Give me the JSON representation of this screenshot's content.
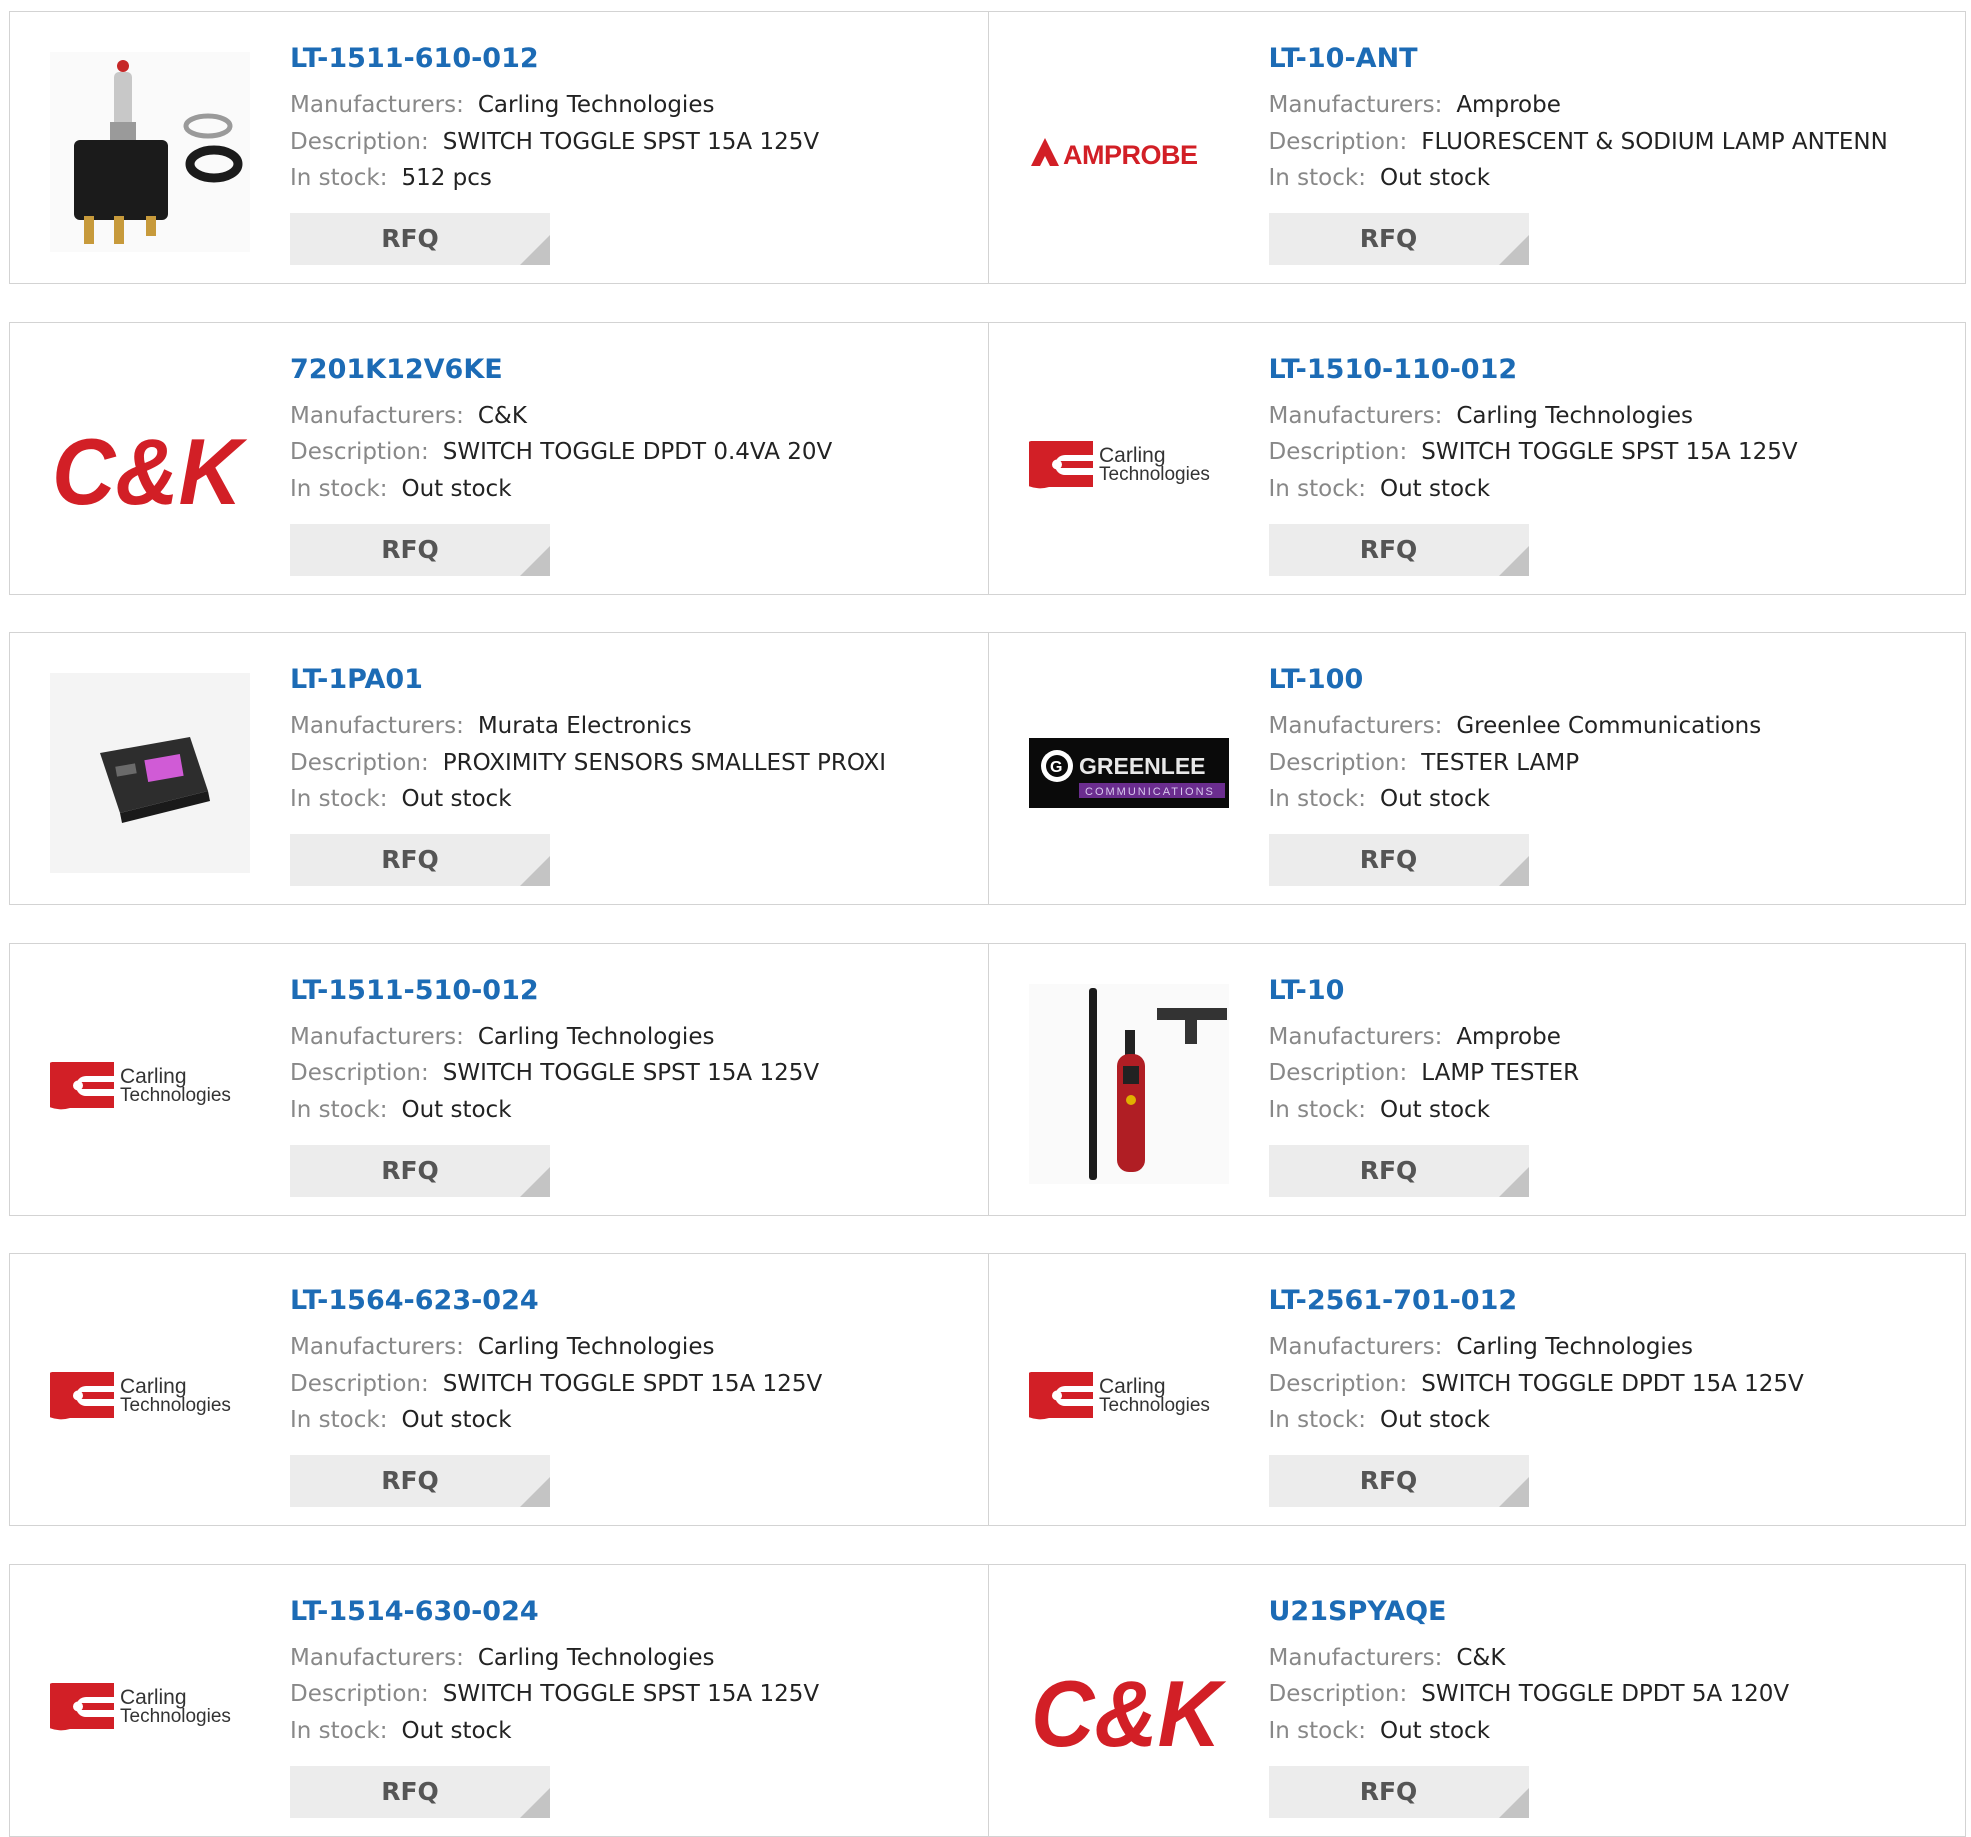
{
  "labels": {
    "manufacturers": "Manufacturers:",
    "description": "Description:",
    "in_stock": "In stock:",
    "rfq": "RFQ"
  },
  "colors": {
    "link": "#1c6bb5",
    "label": "#888888",
    "value": "#222222",
    "rfq_bg": "#ececec",
    "brand_red": "#d21f26"
  },
  "products": [
    {
      "part": "LT-1511-610-012",
      "manufacturer": "Carling Technologies",
      "description": "SWITCH TOGGLE SPST 15A 125V",
      "stock": "512 pcs",
      "image": "toggle-switch-photo"
    },
    {
      "part": "LT-10-ANT",
      "manufacturer": "Amprobe",
      "description": "FLUORESCENT & SODIUM LAMP ANTENN",
      "stock": "Out stock",
      "image": "amprobe-logo"
    },
    {
      "part": "7201K12V6KE",
      "manufacturer": "C&K",
      "description": "SWITCH TOGGLE DPDT 0.4VA 20V",
      "stock": "Out stock",
      "image": "ck-logo"
    },
    {
      "part": "LT-1510-110-012",
      "manufacturer": "Carling Technologies",
      "description": "SWITCH TOGGLE SPST 15A 125V",
      "stock": "Out stock",
      "image": "carling-logo"
    },
    {
      "part": "LT-1PA01",
      "manufacturer": "Murata Electronics",
      "description": "PROXIMITY SENSORS SMALLEST PROXI",
      "stock": "Out stock",
      "image": "sensor-photo"
    },
    {
      "part": "LT-100",
      "manufacturer": "Greenlee Communications",
      "description": "TESTER LAMP",
      "stock": "Out stock",
      "image": "greenlee-logo"
    },
    {
      "part": "LT-1511-510-012",
      "manufacturer": "Carling Technologies",
      "description": "SWITCH TOGGLE SPST 15A 125V",
      "stock": "Out stock",
      "image": "carling-logo"
    },
    {
      "part": "LT-10",
      "manufacturer": "Amprobe",
      "description": "LAMP TESTER",
      "stock": "Out stock",
      "image": "lamp-tester-photo"
    },
    {
      "part": "LT-1564-623-024",
      "manufacturer": "Carling Technologies",
      "description": "SWITCH TOGGLE SPDT 15A 125V",
      "stock": "Out stock",
      "image": "carling-logo"
    },
    {
      "part": "LT-2561-701-012",
      "manufacturer": "Carling Technologies",
      "description": "SWITCH TOGGLE DPDT 15A 125V",
      "stock": "Out stock",
      "image": "carling-logo"
    },
    {
      "part": "LT-1514-630-024",
      "manufacturer": "Carling Technologies",
      "description": "SWITCH TOGGLE SPST 15A 125V",
      "stock": "Out stock",
      "image": "carling-logo"
    },
    {
      "part": "U21SPYAQE",
      "manufacturer": "C&K",
      "description": "SWITCH TOGGLE DPDT 5A 120V",
      "stock": "Out stock",
      "image": "ck-logo"
    }
  ],
  "logos": {
    "amprobe": "AMPROBE",
    "ck": "C&K",
    "carling_line1": "Carling",
    "carling_line2": "Technologies",
    "greenlee": "GREENLEE",
    "greenlee_sub": "COMMUNICATIONS"
  }
}
